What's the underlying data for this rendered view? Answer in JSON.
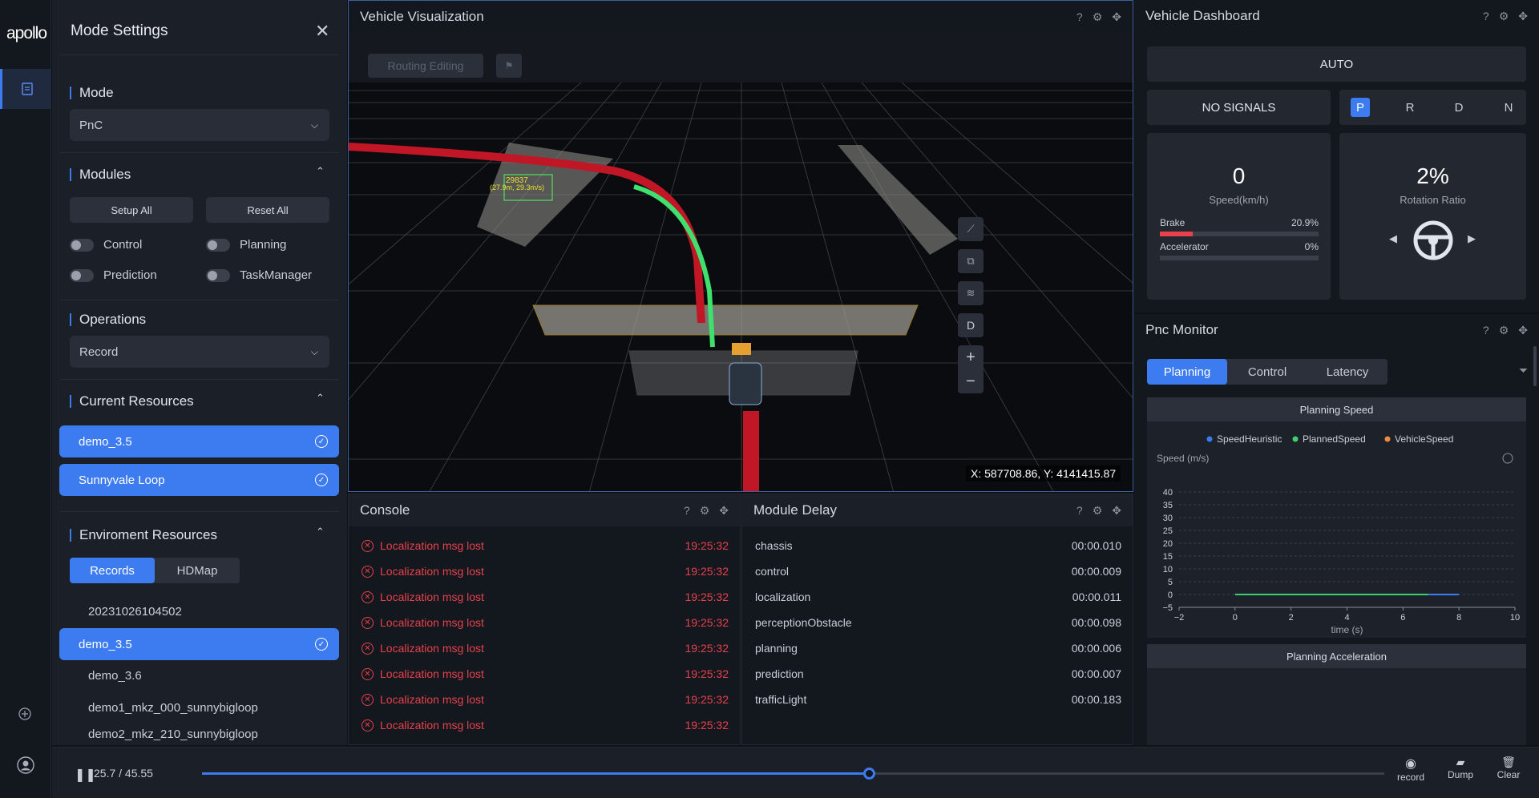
{
  "app": {
    "logo": "apollo"
  },
  "mode_settings": {
    "title": "Mode Settings",
    "mode": {
      "label": "Mode",
      "value": "PnC"
    },
    "modules": {
      "label": "Modules",
      "setup_all": "Setup All",
      "reset_all": "Reset All",
      "items": [
        {
          "label": "Control"
        },
        {
          "label": "Planning"
        },
        {
          "label": "Prediction"
        },
        {
          "label": "TaskManager"
        }
      ]
    },
    "operations": {
      "label": "Operations",
      "value": "Record"
    },
    "current_resources": {
      "label": "Current Resources",
      "items": [
        {
          "label": "demo_3.5"
        },
        {
          "label": "Sunnyvale Loop"
        }
      ]
    },
    "environment_resources": {
      "label": "Enviroment Resources",
      "tabs": [
        {
          "label": "Records"
        },
        {
          "label": "HDMap"
        }
      ],
      "items": [
        {
          "label": "20231026104502"
        },
        {
          "label": "demo_3.5"
        },
        {
          "label": "demo_3.6"
        },
        {
          "label": "demo1_mkz_000_sunnybigloop"
        },
        {
          "label": "demo2_mkz_210_sunnybigloop"
        }
      ]
    }
  },
  "viz": {
    "title": "Vehicle Visualization",
    "routing_editing": "Routing Editing",
    "coords": "X: 587708.86, Y: 4141415.87",
    "view_btn": "D",
    "obstacle_label": "29837",
    "obstacle_sub": "(27.9m, 29.3m/s)"
  },
  "dashboard": {
    "title": "Vehicle Dashboard",
    "mode": "AUTO",
    "signals": "NO SIGNALS",
    "gears": [
      "P",
      "R",
      "D",
      "N"
    ],
    "active_gear": "P",
    "speed_value": "0",
    "speed_label": "Speed(km/h)",
    "brake_label": "Brake",
    "brake_value": "20.9%",
    "brake_fraction": 0.209,
    "accel_label": "Accelerator",
    "accel_value": "0%",
    "accel_fraction": 0,
    "rotation_value": "2%",
    "rotation_label": "Rotation Ratio"
  },
  "pnc": {
    "title": "Pnc Monitor",
    "tabs": [
      {
        "label": "Planning"
      },
      {
        "label": "Control"
      },
      {
        "label": "Latency"
      }
    ],
    "chart1_title": "Planning Speed",
    "chart2_title": "Planning Acceleration",
    "colors": {
      "heuristic": "#3c7bf0",
      "planned": "#3fcf6d",
      "vehicle": "#f08a3c"
    }
  },
  "chart_data": {
    "type": "line",
    "title": "Planning Speed",
    "xlabel": "time (s)",
    "ylabel": "Speed (m/s)",
    "xlim": [
      -2,
      10
    ],
    "ylim": [
      -5,
      40
    ],
    "xticks": [
      "−2",
      "0",
      "2",
      "4",
      "6",
      "8",
      "10"
    ],
    "yticks": [
      "40",
      "35",
      "30",
      "25",
      "20",
      "15",
      "10",
      "5",
      "0",
      "−5"
    ],
    "series": [
      {
        "name": "SpeedHeuristic",
        "x": [
          6.9,
          8
        ],
        "y": [
          0,
          0
        ]
      },
      {
        "name": "PlannedSpeed",
        "x": [
          0,
          6.9
        ],
        "y": [
          0,
          0
        ]
      },
      {
        "name": "VehicleSpeed",
        "x": [],
        "y": []
      }
    ]
  },
  "console": {
    "title": "Console",
    "rows": [
      {
        "msg": "Localization msg lost",
        "time": "19:25:32"
      },
      {
        "msg": "Localization msg lost",
        "time": "19:25:32"
      },
      {
        "msg": "Localization msg lost",
        "time": "19:25:32"
      },
      {
        "msg": "Localization msg lost",
        "time": "19:25:32"
      },
      {
        "msg": "Localization msg lost",
        "time": "19:25:32"
      },
      {
        "msg": "Localization msg lost",
        "time": "19:25:32"
      },
      {
        "msg": "Localization msg lost",
        "time": "19:25:32"
      },
      {
        "msg": "Localization msg lost",
        "time": "19:25:32"
      }
    ]
  },
  "module_delay": {
    "title": "Module Delay",
    "rows": [
      {
        "name": "chassis",
        "value": "00:00.010"
      },
      {
        "name": "control",
        "value": "00:00.009"
      },
      {
        "name": "localization",
        "value": "00:00.011"
      },
      {
        "name": "perceptionObstacle",
        "value": "00:00.098"
      },
      {
        "name": "planning",
        "value": "00:00.006"
      },
      {
        "name": "prediction",
        "value": "00:00.007"
      },
      {
        "name": "trafficLight",
        "value": "00:00.183"
      }
    ]
  },
  "playback": {
    "time": "25.7 / 45.55",
    "progress_fraction": 0.564,
    "record_label": "record",
    "dump_label": "Dump",
    "clear_label": "Clear"
  }
}
